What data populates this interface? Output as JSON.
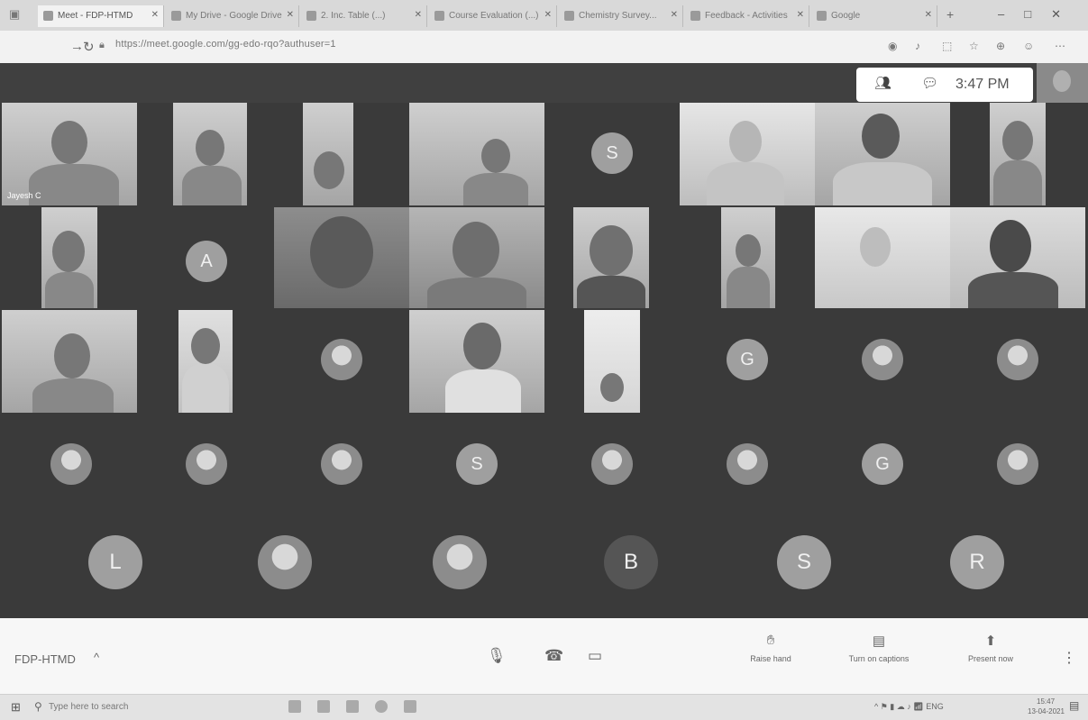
{
  "browser": {
    "tabs": [
      {
        "label": "Meet - FDP-HTMD",
        "active": true
      },
      {
        "label": "My Drive - Google Drive",
        "active": false
      },
      {
        "label": "2. Inc. Table (...)",
        "active": false
      },
      {
        "label": "Course Evaluation (...)",
        "active": false
      },
      {
        "label": "Chemistry Survey...",
        "active": false
      },
      {
        "label": "Feedback - Activities",
        "active": false
      },
      {
        "label": "Google",
        "active": false
      }
    ],
    "url": "https://meet.google.com/gg-edo-rqo?authuser=1"
  },
  "header": {
    "time": "3:47 PM"
  },
  "participants": {
    "first_name_label": "Jayesh C",
    "initials": {
      "r1": "S",
      "r2": "A",
      "r3": "G",
      "r4a": "S",
      "r4b": "G",
      "r5a": "L",
      "r5b": "B",
      "r5c": "S",
      "r5d": "R"
    }
  },
  "controls": {
    "meeting_name": "FDP-HTMD",
    "raise_hand": "Raise hand",
    "captions": "Turn on captions",
    "present": "Present now"
  },
  "taskbar": {
    "search_placeholder": "Type here to search",
    "lang": "ENG",
    "time": "15:47",
    "date": "13-04-2021"
  }
}
